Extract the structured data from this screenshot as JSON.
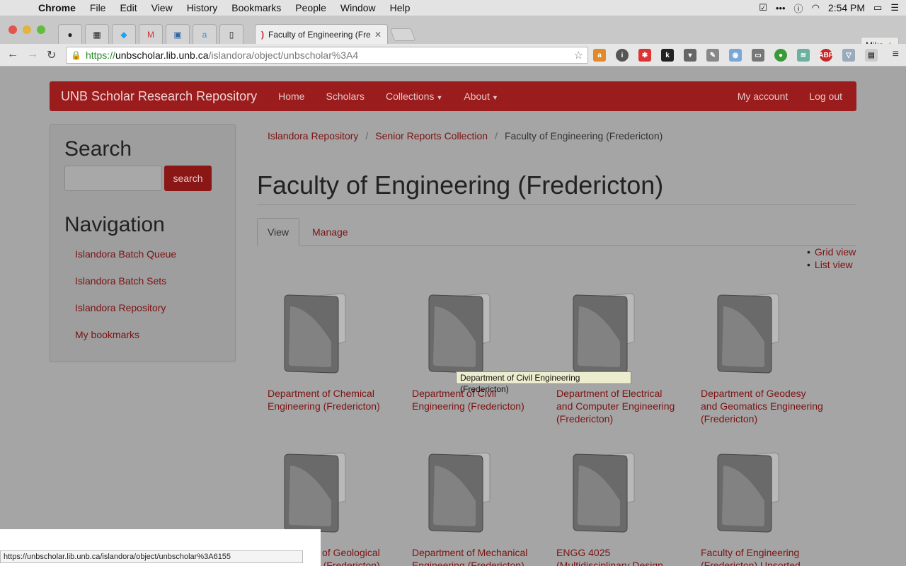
{
  "menubar": {
    "app": "Chrome",
    "items": [
      "File",
      "Edit",
      "View",
      "History",
      "Bookmarks",
      "People",
      "Window",
      "Help"
    ],
    "clock": "2:54 PM"
  },
  "browser": {
    "tab_title": "Faculty of Engineering (Fre",
    "profile": "Mike",
    "url_scheme": "https://",
    "url_host": "unbscholar.lib.unb.ca",
    "url_path": "/islandora/object/unbscholar%3A4",
    "status_url": "https://unbscholar.lib.unb.ca/islandora/object/unbscholar%3A6155"
  },
  "site": {
    "brand": "UNB Scholar Research Repository",
    "nav": [
      "Home",
      "Scholars",
      "Collections",
      "About"
    ],
    "nav_right": [
      "My account",
      "Log out"
    ]
  },
  "sidebar": {
    "search_title": "Search",
    "search_button": "search",
    "nav_title": "Navigation",
    "nav_items": [
      "Islandora Batch Queue",
      "Islandora Batch Sets",
      "Islandora Repository",
      "My bookmarks"
    ]
  },
  "breadcrumb": [
    "Islandora Repository",
    "Senior Reports Collection",
    "Faculty of Engineering (Fredericton)"
  ],
  "page_title": "Faculty of Engineering (Fredericton)",
  "tabs": [
    "View",
    "Manage"
  ],
  "view_modes": [
    "Grid view",
    "List view"
  ],
  "items": [
    {
      "l1": "Department of Chemical",
      "l2": "Engineering (Fredericton)",
      "l3": ""
    },
    {
      "l1": "Department of Civil",
      "l2": "Engineering (Fredericton)",
      "l3": ""
    },
    {
      "l1": "Department of Electrical",
      "l2": "and Computer Engineering",
      "l3": "(Fredericton)"
    },
    {
      "l1": "Department of Geodesy",
      "l2": "and Geomatics Engineering",
      "l3": "(Fredericton)"
    },
    {
      "l1": "Department of Geological",
      "l2": "Engineering (Fredericton)",
      "l3": ""
    },
    {
      "l1": "Department of Mechanical",
      "l2": "Engineering (Fredericton)",
      "l3": ""
    },
    {
      "l1": "ENGG 4025",
      "l2": "(Multidisciplinary Design",
      "l3": ""
    },
    {
      "l1": "Faculty of Engineering",
      "l2": "(Fredericton) Unsorted",
      "l3": ""
    }
  ],
  "tooltip": "Department of Civil Engineering (Fredericton)"
}
